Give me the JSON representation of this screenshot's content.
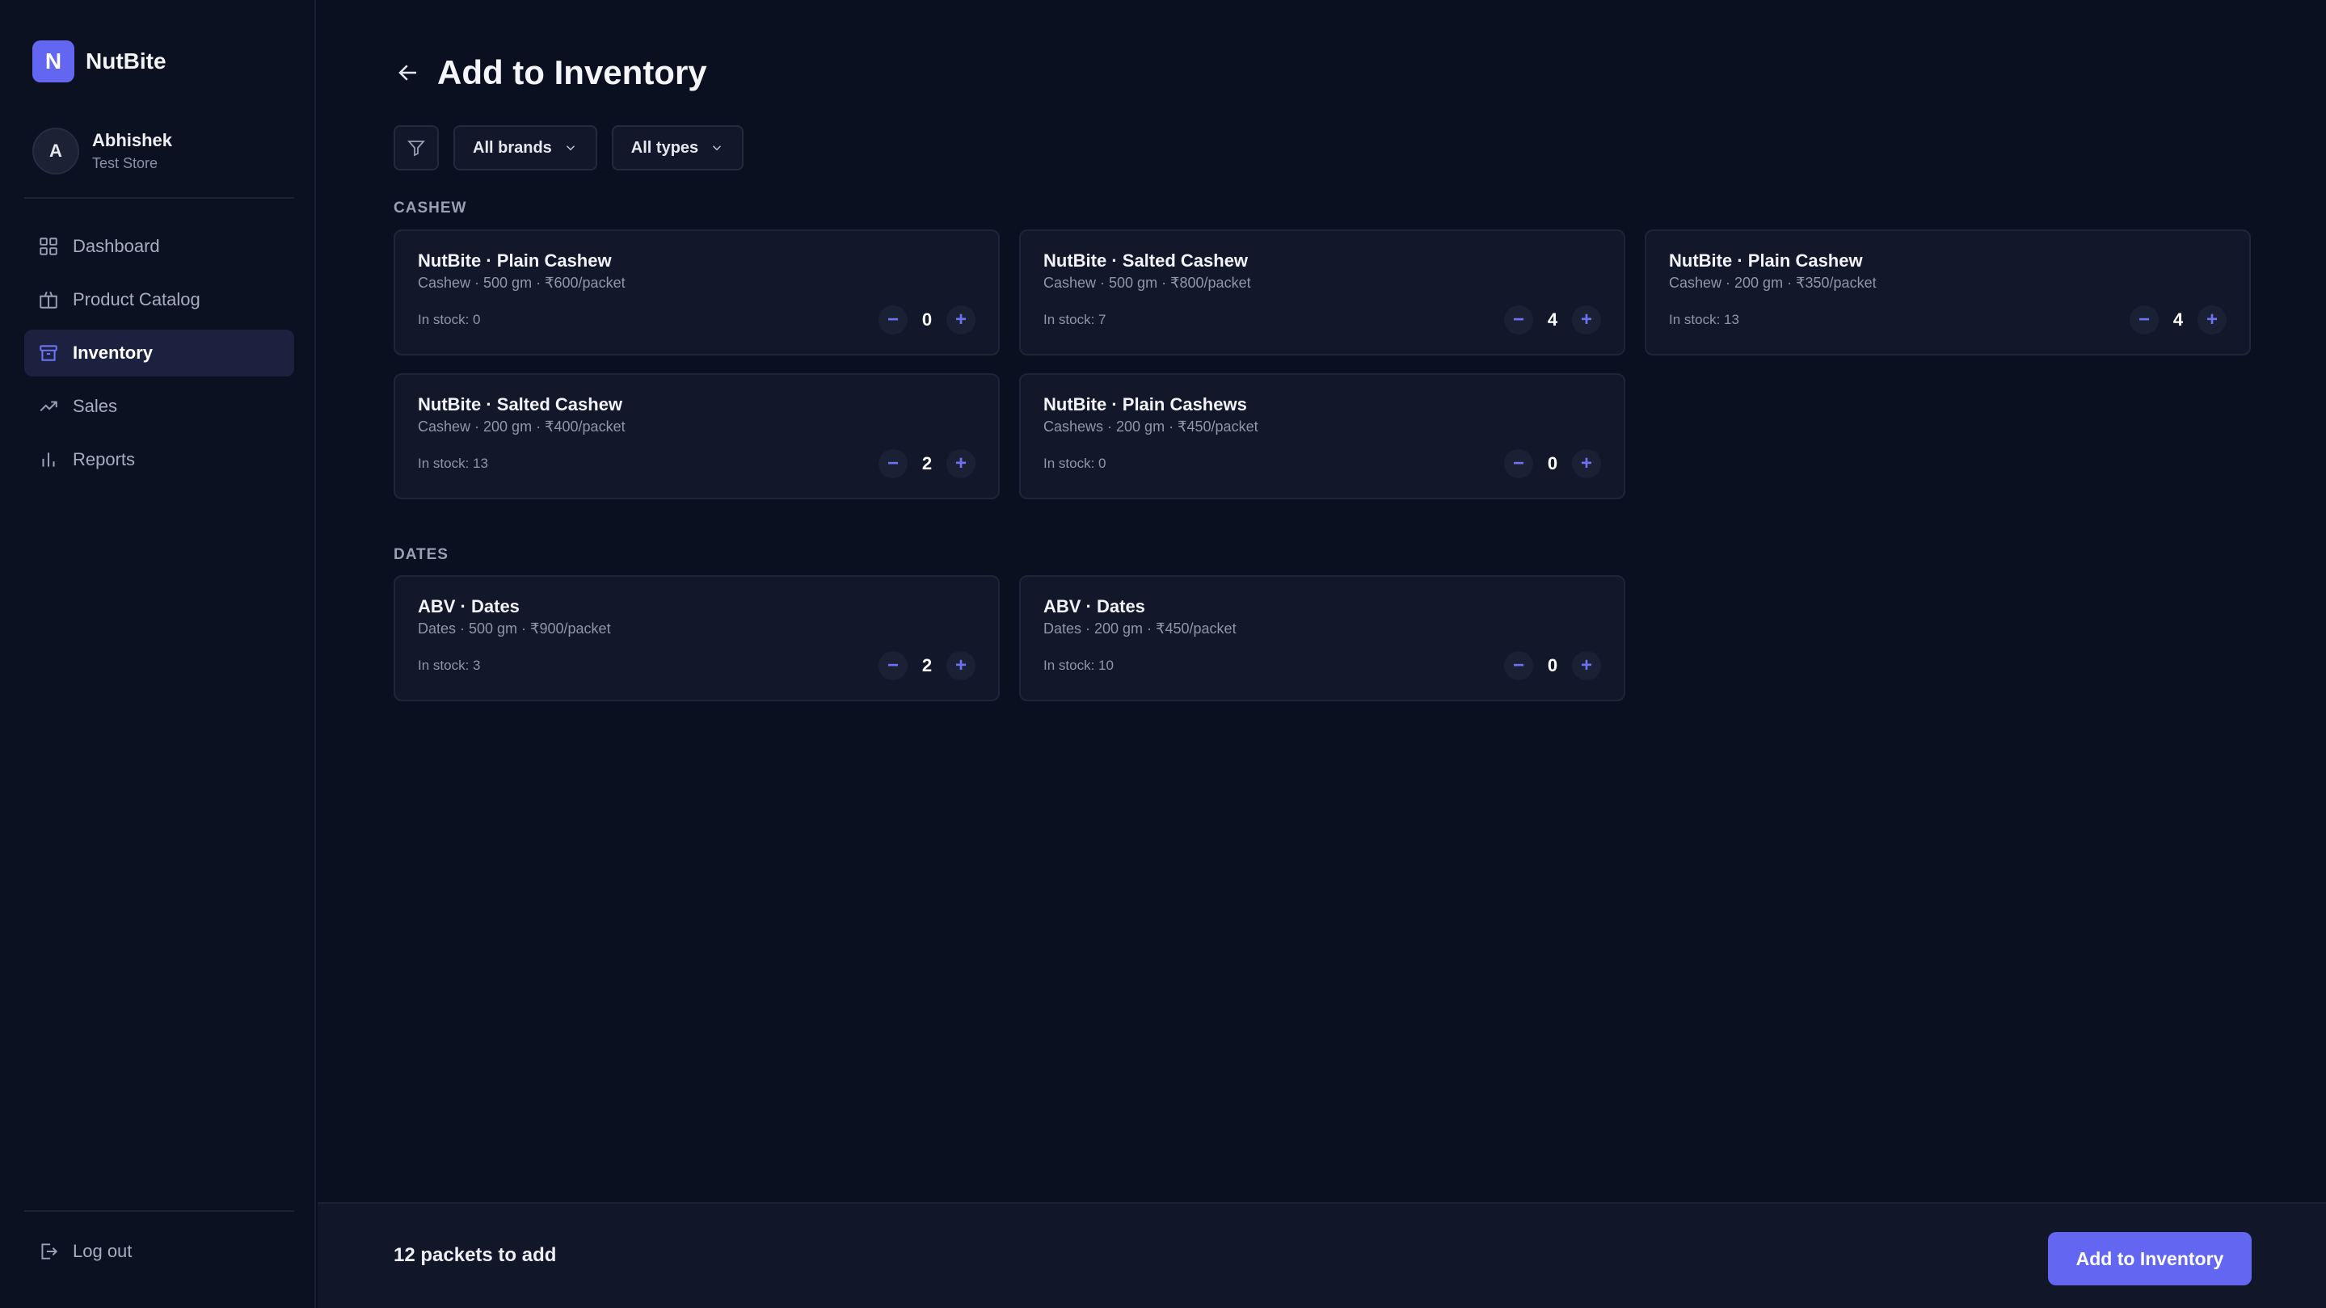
{
  "brand": {
    "logo_letter": "N",
    "name": "NutBite"
  },
  "user": {
    "initial": "A",
    "name": "Abhishek",
    "store": "Test Store"
  },
  "nav": [
    {
      "label": "Dashboard",
      "icon": "grid-icon"
    },
    {
      "label": "Product Catalog",
      "icon": "box-icon"
    },
    {
      "label": "Inventory",
      "icon": "archive-icon",
      "active": true
    },
    {
      "label": "Sales",
      "icon": "trending-up-icon"
    },
    {
      "label": "Reports",
      "icon": "bar-chart-icon"
    }
  ],
  "logout_label": "Log out",
  "page": {
    "title": "Add to Inventory"
  },
  "filters": {
    "brand": "All brands",
    "type": "All types"
  },
  "sections": [
    {
      "label": "CASHEW",
      "cards": [
        {
          "title": "NutBite · Plain Cashew",
          "sub": "Cashew · 500 gm · ₹600/packet",
          "stock": "In stock: 0",
          "qty": "0"
        },
        {
          "title": "NutBite · Salted Cashew",
          "sub": "Cashew · 500 gm · ₹800/packet",
          "stock": "In stock: 7",
          "qty": "4"
        },
        {
          "title": "NutBite · Plain Cashew",
          "sub": "Cashew · 200 gm · ₹350/packet",
          "stock": "In stock: 13",
          "qty": "4"
        },
        {
          "title": "NutBite · Salted Cashew",
          "sub": "Cashew · 200 gm · ₹400/packet",
          "stock": "In stock: 13",
          "qty": "2"
        },
        {
          "title": "NutBite · Plain Cashews",
          "sub": "Cashews · 200 gm · ₹450/packet",
          "stock": "In stock: 0",
          "qty": "0"
        }
      ]
    },
    {
      "label": "DATES",
      "cards": [
        {
          "title": "ABV · Dates",
          "sub": "Dates · 500 gm · ₹900/packet",
          "stock": "In stock: 3",
          "qty": "2"
        },
        {
          "title": "ABV · Dates",
          "sub": "Dates · 200 gm · ₹450/packet",
          "stock": "In stock: 10",
          "qty": "0"
        }
      ]
    }
  ],
  "stepper": {
    "minus": "−",
    "plus": "+"
  },
  "footer": {
    "count_text": "12 packets to add",
    "button_label": "Add to Inventory"
  },
  "colors": {
    "accent": "#6366f1",
    "background": "#0b1020",
    "card": "#121829"
  }
}
